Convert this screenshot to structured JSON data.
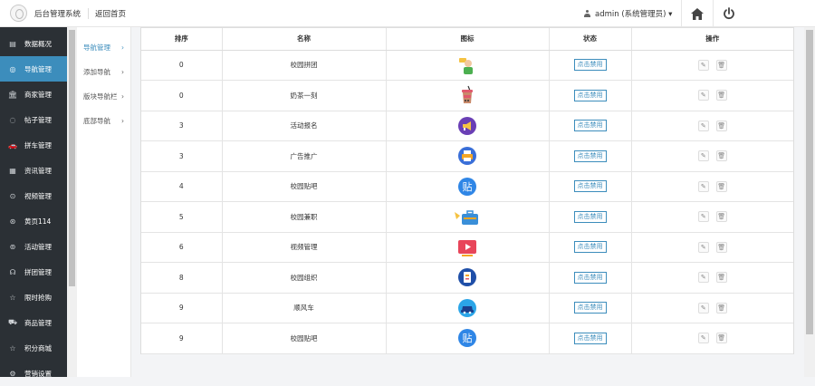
{
  "header": {
    "app_title": "后台管理系统",
    "back_label": "返回首页",
    "user_label": "admin (系统管理员) ▾"
  },
  "sidebar": {
    "items": [
      {
        "label": "数据概况",
        "icon": "dashboard-icon"
      },
      {
        "label": "导航管理",
        "icon": "compass-icon",
        "active": true
      },
      {
        "label": "商家管理",
        "icon": "bank-icon"
      },
      {
        "label": "帖子管理",
        "icon": "comment-icon"
      },
      {
        "label": "拼车管理",
        "icon": "car-icon"
      },
      {
        "label": "资讯管理",
        "icon": "news-icon"
      },
      {
        "label": "视频管理",
        "icon": "play-icon"
      },
      {
        "label": "黄页114",
        "icon": "phonebook-icon"
      },
      {
        "label": "活动管理",
        "icon": "activity-icon"
      },
      {
        "label": "拼团管理",
        "icon": "group-icon"
      },
      {
        "label": "限时抢购",
        "icon": "star-icon"
      },
      {
        "label": "商品管理",
        "icon": "cart-icon"
      },
      {
        "label": "积分商城",
        "icon": "star-icon"
      },
      {
        "label": "营销设置",
        "icon": "settings-icon"
      }
    ]
  },
  "submenu": {
    "items": [
      {
        "label": "导航管理",
        "active": true
      },
      {
        "label": "添加导航"
      },
      {
        "label": "版块导航栏"
      },
      {
        "label": "底部导航"
      }
    ]
  },
  "table": {
    "columns": [
      "排序",
      "名称",
      "图标",
      "状态",
      "操作"
    ],
    "rows": [
      {
        "sort": "0",
        "name": "校园拼团",
        "icon": "group-buy-icon",
        "status": "点击禁用"
      },
      {
        "sort": "0",
        "name": "奶茶一刻",
        "icon": "milk-tea-icon",
        "status": "点击禁用"
      },
      {
        "sort": "3",
        "name": "活动报名",
        "icon": "megaphone-icon",
        "status": "点击禁用"
      },
      {
        "sort": "3",
        "name": "广告推广",
        "icon": "printer-icon",
        "status": "点击禁用"
      },
      {
        "sort": "4",
        "name": "校园贴吧",
        "icon": "post-bar-icon",
        "status": "点击禁用"
      },
      {
        "sort": "5",
        "name": "校园兼职",
        "icon": "briefcase-icon",
        "status": "点击禁用"
      },
      {
        "sort": "6",
        "name": "视频管理",
        "icon": "video-icon",
        "status": "点击禁用"
      },
      {
        "sort": "8",
        "name": "校园组织",
        "icon": "organization-icon",
        "status": "点击禁用"
      },
      {
        "sort": "9",
        "name": "顺风车",
        "icon": "carpool-icon",
        "status": "点击禁用"
      },
      {
        "sort": "9",
        "name": "校园贴吧",
        "icon": "post-bar-icon",
        "status": "点击禁用"
      }
    ],
    "post_bar_glyph": "贴"
  },
  "colors": {
    "accent": "#3c8dbc",
    "sidebar_bg": "#2b3035"
  }
}
